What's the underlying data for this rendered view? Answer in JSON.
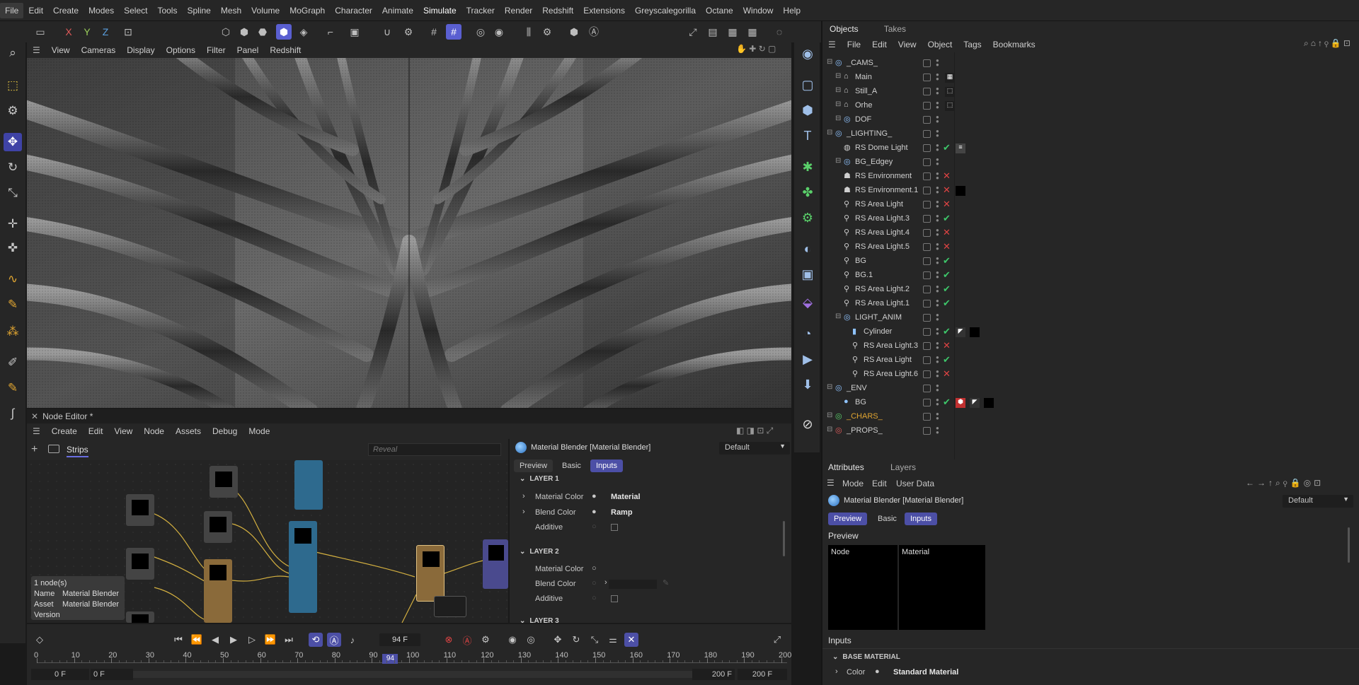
{
  "menubar": [
    "File",
    "Edit",
    "Create",
    "Modes",
    "Select",
    "Tools",
    "Spline",
    "Mesh",
    "Volume",
    "MoGraph",
    "Character",
    "Animate",
    "Simulate",
    "Tracker",
    "Render",
    "Redshift",
    "Extensions",
    "Greyscalegorilla",
    "Octane",
    "Window",
    "Help"
  ],
  "toolbar": {
    "axis_x": "X",
    "axis_y": "Y",
    "axis_z": "Z"
  },
  "viewport": {
    "menu": [
      "View",
      "Cameras",
      "Display",
      "Options",
      "Filter",
      "Panel",
      "Redshift"
    ]
  },
  "node_editor": {
    "title": "Node Editor *",
    "menu": [
      "Create",
      "Edit",
      "View",
      "Node",
      "Assets",
      "Debug",
      "Mode"
    ],
    "tab": "Strips",
    "search_placeholder": "Reveal",
    "info": {
      "count": "1 node(s)",
      "name_label": "Name",
      "name_value": "Material Blender",
      "asset_label": "Asset",
      "asset_value": "Material Blender",
      "version_label": "Version"
    },
    "panel": {
      "title": "Material Blender [Material Blender]",
      "preset": "Default",
      "tabs": [
        "Preview",
        "Basic",
        "Inputs"
      ],
      "layer1": "LAYER 1",
      "layer2": "LAYER 2",
      "layer3": "LAYER 3",
      "l1_rows": [
        {
          "label": "Material Color",
          "value": "Material"
        },
        {
          "label": "Blend Color",
          "value": "Ramp"
        },
        {
          "label": "Additive",
          "value": ""
        }
      ],
      "l2_rows": [
        {
          "label": "Material Color",
          "value": ""
        },
        {
          "label": "Blend Color",
          "value": ""
        },
        {
          "label": "Additive",
          "value": ""
        }
      ]
    }
  },
  "timeline": {
    "current_frame": "94 F",
    "ticks": [
      "0",
      "10",
      "20",
      "30",
      "40",
      "50",
      "60",
      "70",
      "80",
      "90",
      "100",
      "110",
      "120",
      "130",
      "140",
      "150",
      "160",
      "170",
      "180",
      "190",
      "200"
    ],
    "playhead_label": "94",
    "start_a": "0 F",
    "start_b": "0 F",
    "end_a": "200 F",
    "end_b": "200 F",
    "current_frame_value": 94
  },
  "objects": {
    "tabs": [
      "Objects",
      "Takes"
    ],
    "menu": [
      "File",
      "Edit",
      "View",
      "Object",
      "Tags",
      "Bookmarks"
    ],
    "rows": [
      {
        "name": "_CAMS_",
        "indent": 0,
        "icon": "null",
        "status": ""
      },
      {
        "name": "Main",
        "indent": 1,
        "icon": "camera",
        "status": ""
      },
      {
        "name": "Still_A",
        "indent": 1,
        "icon": "camera",
        "status": ""
      },
      {
        "name": "Orhe",
        "indent": 1,
        "icon": "camera",
        "status": ""
      },
      {
        "name": "DOF",
        "indent": 1,
        "icon": "null",
        "status": ""
      },
      {
        "name": "_LIGHTING_",
        "indent": 0,
        "icon": "null",
        "status": ""
      },
      {
        "name": "RS Dome Light",
        "indent": 1,
        "icon": "dome",
        "status": "ok"
      },
      {
        "name": "BG_Edgey",
        "indent": 1,
        "icon": "null",
        "status": ""
      },
      {
        "name": "RS Environment",
        "indent": 1,
        "icon": "env",
        "status": "no"
      },
      {
        "name": "RS Environment.1",
        "indent": 1,
        "icon": "env",
        "status": "no"
      },
      {
        "name": "RS Area Light",
        "indent": 1,
        "icon": "light",
        "status": "no"
      },
      {
        "name": "RS Area Light.3",
        "indent": 1,
        "icon": "light",
        "status": "ok"
      },
      {
        "name": "RS Area Light.4",
        "indent": 1,
        "icon": "light",
        "status": "no"
      },
      {
        "name": "RS Area Light.5",
        "indent": 1,
        "icon": "light",
        "status": "no"
      },
      {
        "name": "BG",
        "indent": 1,
        "icon": "light",
        "status": "ok"
      },
      {
        "name": "BG.1",
        "indent": 1,
        "icon": "light",
        "status": "ok"
      },
      {
        "name": "RS Area Light.2",
        "indent": 1,
        "icon": "light",
        "status": "ok"
      },
      {
        "name": "RS Area Light.1",
        "indent": 1,
        "icon": "light",
        "status": "ok"
      },
      {
        "name": "LIGHT_ANIM",
        "indent": 1,
        "icon": "null",
        "status": ""
      },
      {
        "name": "Cylinder",
        "indent": 2,
        "icon": "cyl",
        "status": "ok"
      },
      {
        "name": "RS Area Light.3",
        "indent": 2,
        "icon": "light",
        "status": "no"
      },
      {
        "name": "RS Area Light",
        "indent": 2,
        "icon": "light",
        "status": "ok"
      },
      {
        "name": "RS Area Light.6",
        "indent": 2,
        "icon": "light",
        "status": "no"
      },
      {
        "name": "_ENV",
        "indent": 0,
        "icon": "null",
        "status": ""
      },
      {
        "name": "BG",
        "indent": 1,
        "icon": "sphere",
        "status": "ok"
      },
      {
        "name": "_CHARS_",
        "indent": 0,
        "icon": "nullgreen",
        "status": ""
      },
      {
        "name": "_PROPS_",
        "indent": 0,
        "icon": "nullred",
        "status": ""
      }
    ]
  },
  "attributes": {
    "tabs": [
      "Attributes",
      "Layers"
    ],
    "menu": [
      "Mode",
      "Edit",
      "User Data"
    ],
    "title": "Material Blender [Material Blender]",
    "preset": "Default",
    "sub_tabs": [
      "Preview",
      "Basic",
      "Inputs"
    ],
    "preview_label": "Preview",
    "preview_node": "Node",
    "preview_material": "Material",
    "inputs_label": "Inputs",
    "base_material": "BASE MATERIAL",
    "color_label": "Color",
    "color_value": "Standard Material"
  },
  "colors": {
    "accent": "#5a5fd1",
    "ok": "#3ec76a",
    "no": "#e04444",
    "label_yellow": "#e0a531"
  }
}
